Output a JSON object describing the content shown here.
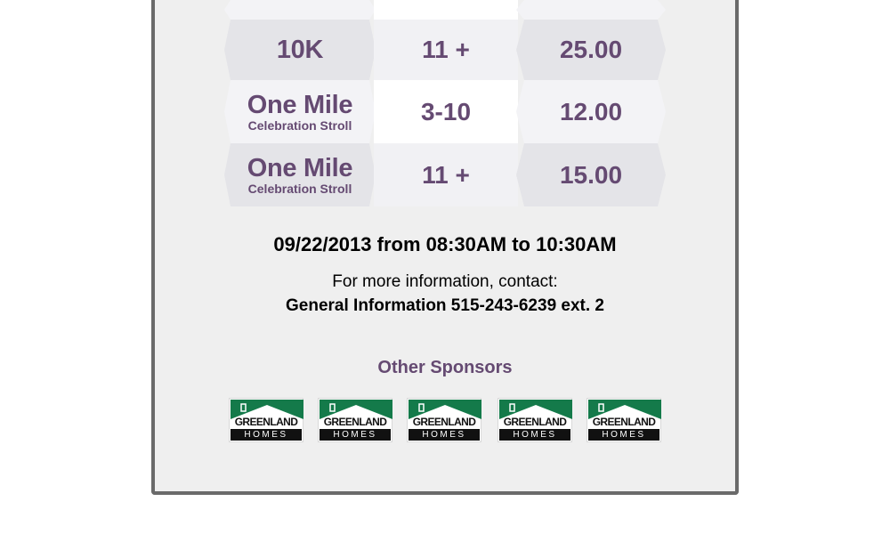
{
  "pricing_table": {
    "rows": [
      {
        "event": "",
        "sub": "",
        "age": "",
        "price": ""
      },
      {
        "event": "10K",
        "sub": "",
        "age": "11 +",
        "price": "25.00"
      },
      {
        "event": "One Mile",
        "sub": "Celebration Stroll",
        "age": "3-10",
        "price": "12.00"
      },
      {
        "event": "One Mile",
        "sub": "Celebration Stroll",
        "age": "11 +",
        "price": "15.00"
      }
    ]
  },
  "event_datetime": "09/22/2013 from 08:30AM to 10:30AM",
  "contact": {
    "label": "For more information, contact:",
    "value": "General Information 515-243-6239 ext. 2"
  },
  "sponsors": {
    "title": "Other Sponsors",
    "logos": [
      {
        "line1": "GREENLAND",
        "line2": "HOMES"
      },
      {
        "line1": "GREENLAND",
        "line2": "HOMES"
      },
      {
        "line1": "GREENLAND",
        "line2": "HOMES"
      },
      {
        "line1": "GREENLAND",
        "line2": "HOMES"
      },
      {
        "line1": "GREENLAND",
        "line2": "HOMES"
      }
    ]
  },
  "colors": {
    "accent_purple": "#654a72",
    "logo_green": "#147a4a",
    "card_border": "#6a6a6a",
    "card_background": "#efefef"
  }
}
